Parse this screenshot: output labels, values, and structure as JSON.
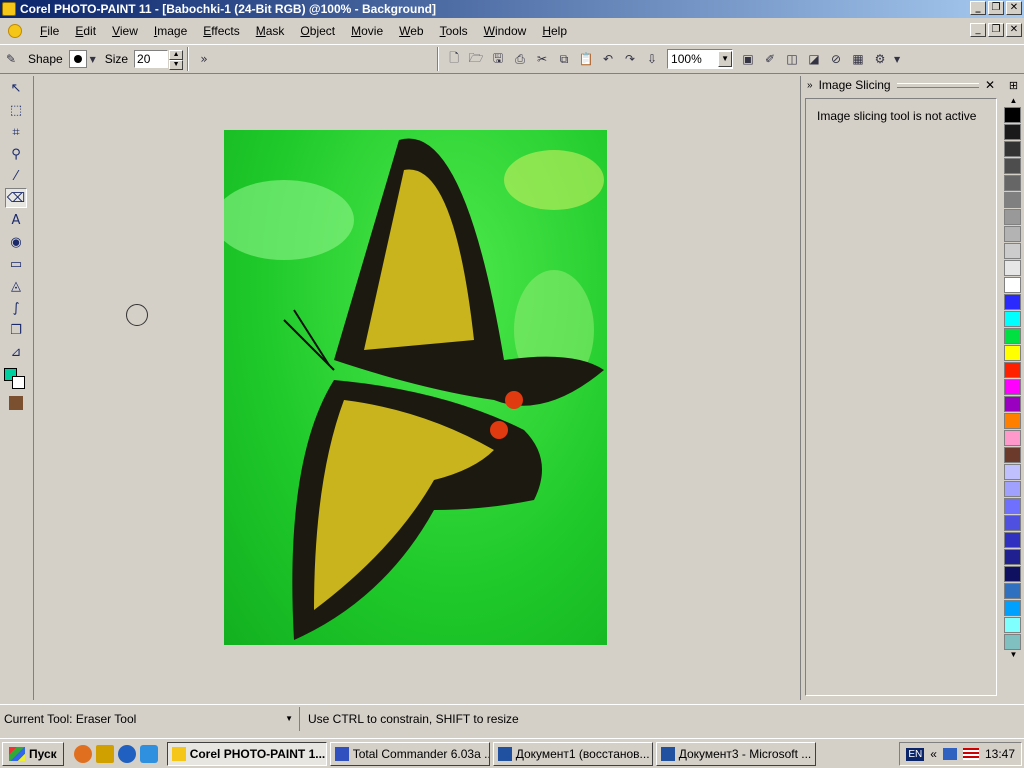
{
  "window": {
    "title": "Corel PHOTO-PAINT 11 - [Babochki-1 (24-Bit RGB) @100% - Background]",
    "minimize": "_",
    "restore": "❐",
    "close": "✕"
  },
  "menu": [
    "File",
    "Edit",
    "View",
    "Image",
    "Effects",
    "Mask",
    "Object",
    "Movie",
    "Web",
    "Tools",
    "Window",
    "Help"
  ],
  "property_bar": {
    "shape_label": "Shape",
    "size_label": "Size",
    "size_value": "20",
    "zoom_value": "100%"
  },
  "docker": {
    "title": "Image Slicing",
    "message": "Image slicing tool is not active",
    "close": "✕"
  },
  "palette_colors": [
    "#000000",
    "#1a1a1a",
    "#333333",
    "#4d4d4d",
    "#666666",
    "#808080",
    "#999999",
    "#b3b3b3",
    "#cccccc",
    "#e6e6e6",
    "#ffffff",
    "#2a2aff",
    "#00ffff",
    "#00e040",
    "#ffff00",
    "#ff2000",
    "#ff00ff",
    "#9a00c0",
    "#ff8000",
    "#ff99cc",
    "#6b3a2a",
    "#c0c0ff",
    "#a0a0ff",
    "#7070ff",
    "#5050e0",
    "#3030c0",
    "#202090",
    "#101060",
    "#3070c0",
    "#00a0ff",
    "#80ffff",
    "#80c0c0"
  ],
  "status": {
    "current_tool": "Current Tool: Eraser Tool",
    "hint": "Use CTRL to constrain, SHIFT to resize"
  },
  "taskbar": {
    "start": "Пуск",
    "tasks": [
      {
        "label": "Corel PHOTO-PAINT 1...",
        "active": true,
        "color": "#f5c518"
      },
      {
        "label": "Total Commander 6.03a ...",
        "active": false,
        "color": "#3050c0"
      },
      {
        "label": "Документ1 (восстанов...",
        "active": false,
        "color": "#2050a0"
      },
      {
        "label": "Документ3 - Microsoft ...",
        "active": false,
        "color": "#2050a0"
      }
    ],
    "language": "EN",
    "clock": "13:47"
  }
}
